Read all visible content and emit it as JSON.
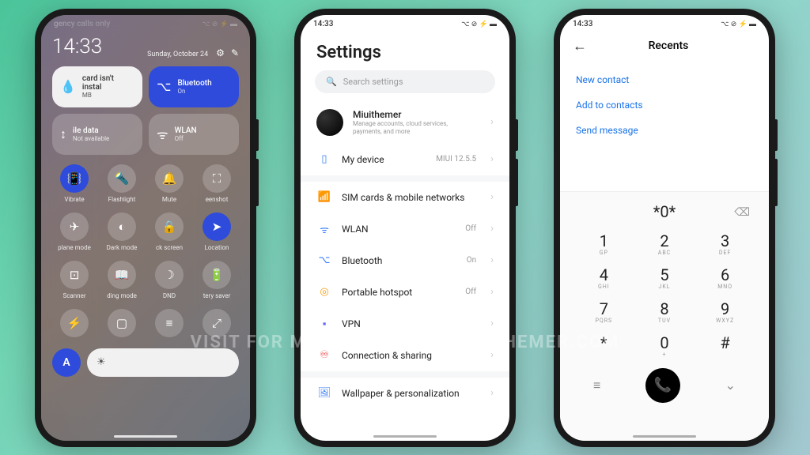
{
  "status": {
    "time": "14:33",
    "carrier": "gency calls only",
    "icons": "⌥ ⊘ ⚡ ▬"
  },
  "cc": {
    "time": "14:33",
    "date": "Sunday, October 24",
    "tiles": {
      "data": {
        "title": "card isn't instal",
        "sub": "MB"
      },
      "bt": {
        "title": "Bluetooth",
        "sub": "On"
      },
      "mobile": {
        "title": "ile data",
        "sub": "Not available"
      },
      "wlan": {
        "title": "WLAN",
        "sub": "Off"
      }
    },
    "grid": [
      {
        "icon": "📳",
        "label": "Vibrate",
        "active": true
      },
      {
        "icon": "🔦",
        "label": "Flashlight",
        "active": false
      },
      {
        "icon": "🔔",
        "label": "Mute",
        "active": false
      },
      {
        "icon": "⛶",
        "label": "eenshot",
        "active": false
      },
      {
        "icon": "✈",
        "label": "plane mode",
        "active": false
      },
      {
        "icon": "◐",
        "label": "Dark mode",
        "active": false
      },
      {
        "icon": "🔒",
        "label": "ck screen",
        "active": false
      },
      {
        "icon": "➤",
        "label": "Location",
        "active": true
      },
      {
        "icon": "⊡",
        "label": "Scanner",
        "active": false
      },
      {
        "icon": "📖",
        "label": "ding mode",
        "active": false
      },
      {
        "icon": "☽",
        "label": "DND",
        "active": false
      },
      {
        "icon": "🔋",
        "label": "tery saver",
        "active": false
      },
      {
        "icon": "⚡",
        "label": "",
        "active": false
      },
      {
        "icon": "▢",
        "label": "",
        "active": false
      },
      {
        "icon": "≡",
        "label": "",
        "active": false
      },
      {
        "icon": "⤢",
        "label": "",
        "active": false
      }
    ],
    "auto": "A"
  },
  "settings": {
    "title": "Settings",
    "search_placeholder": "Search settings",
    "profile": {
      "name": "Miuithemer",
      "sub": "Manage accounts, cloud services, payments, and more"
    },
    "mydevice": {
      "label": "My device",
      "value": "MIUI 12.5.5"
    },
    "rows": [
      {
        "icon": "📶",
        "color": "#f5a623",
        "label": "SIM cards & mobile networks",
        "value": ""
      },
      {
        "icon": "ᯤ",
        "color": "#3b82f6",
        "label": "WLAN",
        "value": "Off"
      },
      {
        "icon": "⌥",
        "color": "#3b82f6",
        "label": "Bluetooth",
        "value": "On"
      },
      {
        "icon": "◎",
        "color": "#f59e0b",
        "label": "Portable hotspot",
        "value": "Off"
      },
      {
        "icon": "▪",
        "color": "#6366f1",
        "label": "VPN",
        "value": ""
      },
      {
        "icon": "♾",
        "color": "#ef4444",
        "label": "Connection & sharing",
        "value": ""
      }
    ],
    "wallpaper": {
      "icon": "🖼",
      "label": "Wallpaper & personalization"
    }
  },
  "dialer": {
    "title": "Recents",
    "links": [
      "New contact",
      "Add to contacts",
      "Send message"
    ],
    "number": "*0*",
    "keys": [
      {
        "d": "1",
        "l": "GP"
      },
      {
        "d": "2",
        "l": "ABC"
      },
      {
        "d": "3",
        "l": "DEF"
      },
      {
        "d": "4",
        "l": "GHI"
      },
      {
        "d": "5",
        "l": "JKL"
      },
      {
        "d": "6",
        "l": "MNO"
      },
      {
        "d": "7",
        "l": "PQRS"
      },
      {
        "d": "8",
        "l": "TUV"
      },
      {
        "d": "9",
        "l": "WXYZ"
      },
      {
        "d": "*",
        "l": ""
      },
      {
        "d": "0",
        "l": "+"
      },
      {
        "d": "#",
        "l": ""
      }
    ]
  },
  "watermark": "VISIT FOR MORE THEMES - MIUITHEMER.COM"
}
